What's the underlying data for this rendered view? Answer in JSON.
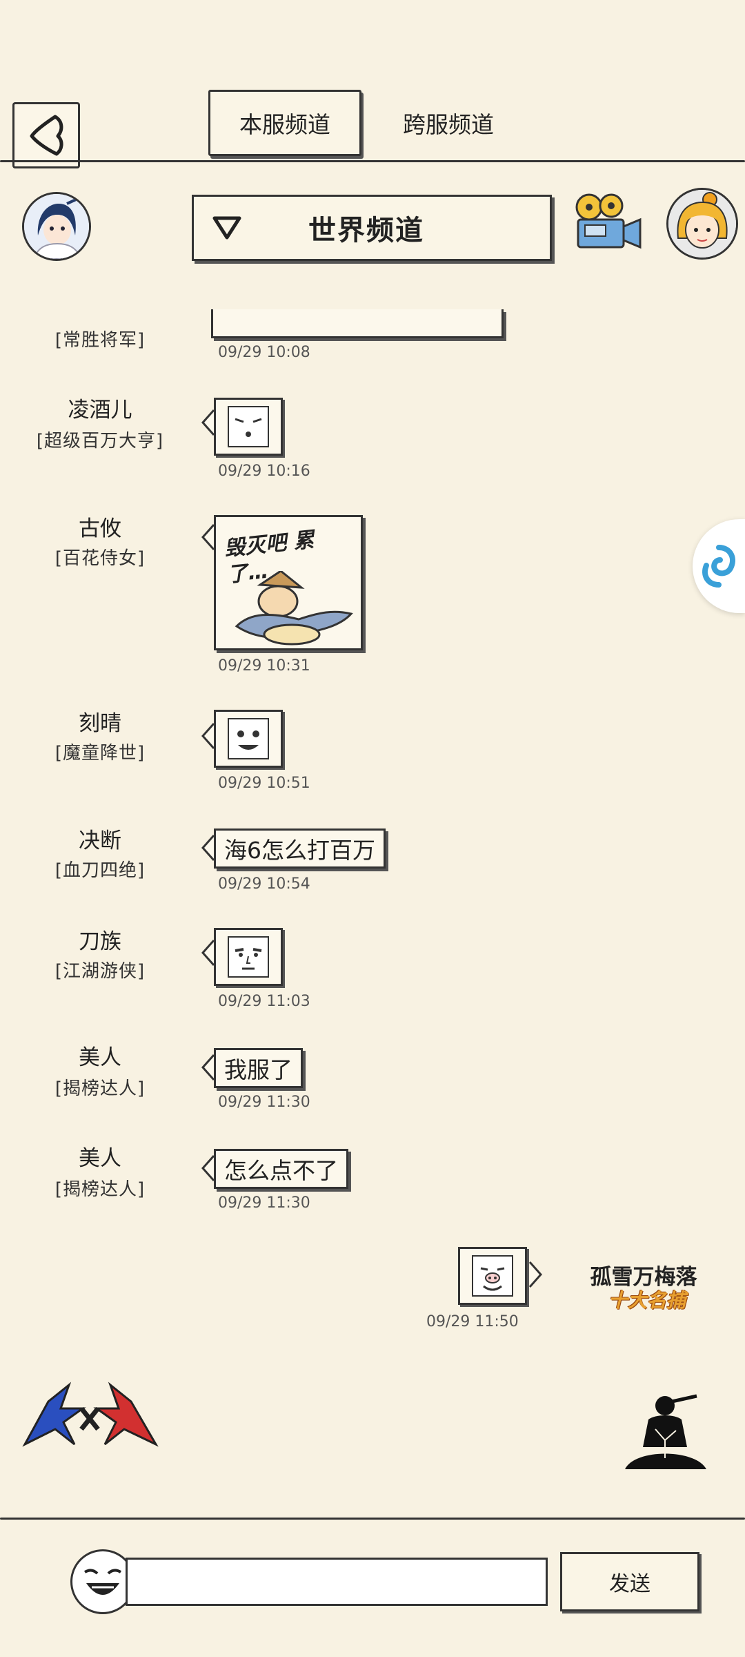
{
  "tabs": {
    "local": "本服频道",
    "cross": "跨服频道"
  },
  "channel": {
    "label": "世界频道"
  },
  "messages": [
    {
      "name": "",
      "title": "[常胜将军]",
      "time": "09/29 10:08"
    },
    {
      "name": "凌酒儿",
      "title": "[超级百万大亨]",
      "time": "09/29 10:16",
      "emote": "squint-face"
    },
    {
      "name": "古攸",
      "title": "[百花侍女]",
      "time": "09/29 10:31",
      "sticker_text": "毁灭吧 累了…"
    },
    {
      "name": "刻晴",
      "title": "[魔童降世]",
      "time": "09/29 10:51",
      "emote": "grin-face"
    },
    {
      "name": "决断",
      "title": "[血刀四绝]",
      "time": "09/29 10:54",
      "text": "海6怎么打百万"
    },
    {
      "name": "刀族",
      "title": "[江湖游侠]",
      "time": "09/29 11:03",
      "emote": "man-face"
    },
    {
      "name": "美人",
      "title": "[揭榜达人]",
      "time": "09/29 11:30",
      "text": "我服了"
    },
    {
      "name": "美人",
      "title": "[揭榜达人]",
      "time": "09/29 11:30",
      "text": "怎么点不了"
    }
  ],
  "self_message": {
    "name": "孤雪万梅落",
    "rank": "十大名捕",
    "time": "09/29 11:50",
    "emote": "pig-face"
  },
  "input": {
    "value": "",
    "send_label": "发送"
  },
  "colors": {
    "background": "#f8f2e2",
    "ink": "#333333",
    "rank_gold": "#e8a030",
    "logo_blue": "#2a4fbf",
    "logo_red": "#d23030"
  }
}
